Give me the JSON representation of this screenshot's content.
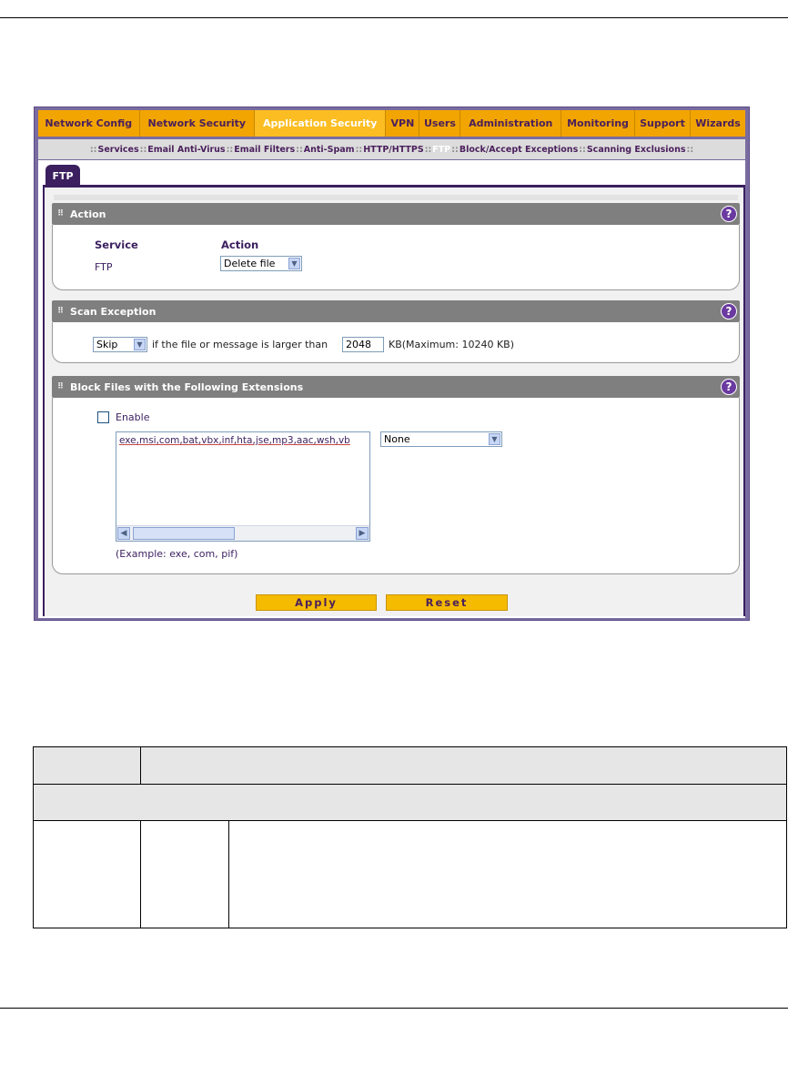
{
  "top_nav": [
    "Network Config",
    "Network Security",
    "Application Security",
    "VPN",
    "Users",
    "Administration",
    "Monitoring",
    "Support",
    "Wizards"
  ],
  "top_nav_active": "Application Security",
  "sub_nav": [
    "Services",
    "Email Anti-Virus",
    "Email Filters",
    "Anti-Spam",
    "HTTP/HTTPS",
    "FTP",
    "Block/Accept Exceptions",
    "Scanning Exclusions"
  ],
  "sub_nav_sep": "::",
  "sub_nav_current": "FTP",
  "tab": {
    "label": "FTP"
  },
  "action": {
    "title": "Action",
    "col_service": "Service",
    "col_action": "Action",
    "service": "FTP",
    "action_value": "Delete file"
  },
  "scan_exception": {
    "title": "Scan Exception",
    "mode": "Skip",
    "text_before": "if the file or message is larger than",
    "size": "2048",
    "text_after": "KB(Maximum: 10240 KB)"
  },
  "block_files": {
    "title": "Block Files with the Following Extensions",
    "enable_label": "Enable",
    "enabled": false,
    "extensions": "exe,msi,com,bat,vbx,inf,hta,jse,mp3,aac,wsh,vb",
    "preset": "None",
    "example": "(Example: exe, com, pif)"
  },
  "buttons": {
    "apply": "Apply",
    "reset": "Reset"
  },
  "help_glyph": "?",
  "colors": {
    "nav_orange": "#f2a400",
    "purple": "#3b1f5f",
    "section_gray": "#7f7f7f"
  }
}
